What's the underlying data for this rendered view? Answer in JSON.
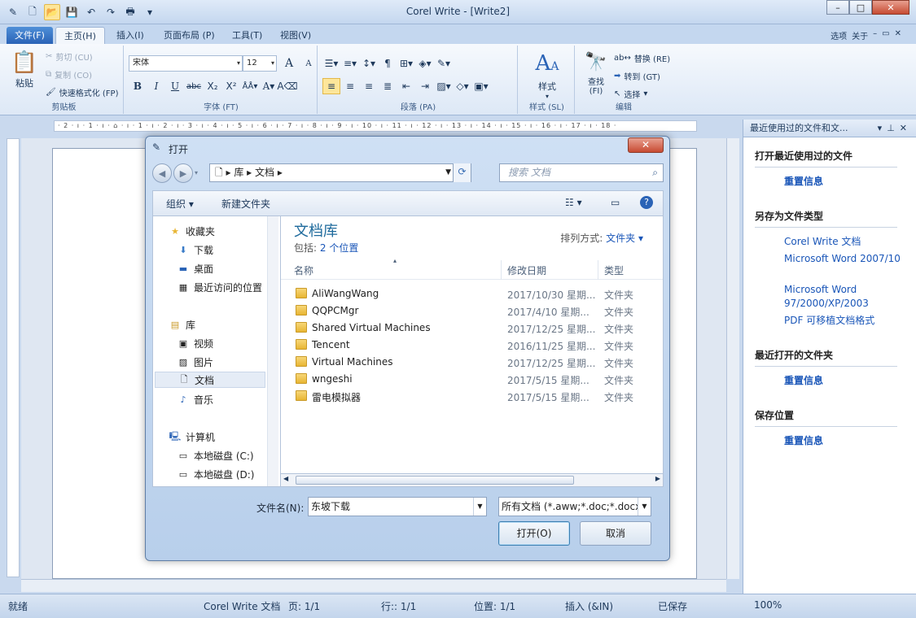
{
  "window": {
    "title": "Corel Write - [Write2]",
    "controls": [
      "–",
      "□",
      "✕"
    ]
  },
  "ribbon_tabs": [
    "文件(F)",
    "主页(H)",
    "插入(I)",
    "页面布局 (P)",
    "工具(T)",
    "视图(V)"
  ],
  "ribbon_right": {
    "options": "选项",
    "about": "关于"
  },
  "clipboard": {
    "paste": "粘贴",
    "cut": "剪切 (CU)",
    "copy": "复制 (CO)",
    "format_painter": "快速格式化 (FP)",
    "label": "剪贴板"
  },
  "font": {
    "name": "宋体",
    "size": "12",
    "label": "字体 (FT)"
  },
  "paragraph": {
    "label": "段落 (PA)"
  },
  "styles": {
    "button": "样式",
    "label": "样式 (SL)"
  },
  "editing": {
    "find": "查找",
    "find_key": "(FI)",
    "replace": "替换 (RE)",
    "goto": "转到 (GT)",
    "select": "选择",
    "label": "编辑"
  },
  "ruler_text": "· 2 · ı · 1 · ı · ⌂ · ı · 1 · ı · 2 · ı · 3 · ı · 4 · ı · 5 · ı · 6 · ı · 7 · ı · 8 · ı · 9 · ı · 10 · ı · 11 · ı · 12 · ı · 13 · ı · 14 · ı · 15 · ı · 16 · ı · 17 · ı · 18 ·",
  "pane": {
    "title": "最近使用过的文件和文...",
    "sections": [
      {
        "heading": "打开最近使用过的文件",
        "links": [
          "重置信息"
        ]
      },
      {
        "heading": "另存为文件类型",
        "links": [
          "Corel Write 文档",
          "Microsoft Word 2007/10",
          "Microsoft Word 97/2000/XP/2003",
          "PDF 可移植文档格式"
        ]
      },
      {
        "heading": "最近打开的文件夹",
        "links": [
          "重置信息"
        ]
      },
      {
        "heading": "保存位置",
        "links": [
          "重置信息"
        ]
      }
    ]
  },
  "statusbar": {
    "ready": "就绪",
    "doctype": "Corel Write 文档",
    "page": "页: 1/1",
    "line": "行:: 1/1",
    "position": "位置: 1/1",
    "insert": "插入 (&IN)",
    "saved": "已保存",
    "zoom": "100%"
  },
  "dialog": {
    "title": "打开",
    "path": [
      "库",
      "文档"
    ],
    "search_placeholder": "搜索 文档",
    "organize": "组织 ▾",
    "new_folder": "新建文件夹",
    "nav": {
      "favorites": "收藏夹",
      "favorites_items": [
        "下载",
        "桌面",
        "最近访问的位置"
      ],
      "libraries": "库",
      "library_items": [
        "视频",
        "图片",
        "文档",
        "音乐"
      ],
      "computer": "计算机",
      "computer_items": [
        "本地磁盘 (C:)",
        "本地磁盘 (D:)"
      ]
    },
    "library_title": "文档库",
    "includes_label": "包括:",
    "includes_link": "2 个位置",
    "sort_label": "排列方式:",
    "sort_value": "文件夹 ▾",
    "columns": [
      "名称",
      "修改日期",
      "类型"
    ],
    "files": [
      {
        "name": "AliWangWang",
        "date": "2017/10/30 星期...",
        "type": "文件夹"
      },
      {
        "name": "QQPCMgr",
        "date": "2017/4/10 星期...",
        "type": "文件夹"
      },
      {
        "name": "Shared Virtual Machines",
        "date": "2017/12/25 星期...",
        "type": "文件夹"
      },
      {
        "name": "Tencent",
        "date": "2016/11/25 星期...",
        "type": "文件夹"
      },
      {
        "name": "Virtual Machines",
        "date": "2017/12/25 星期...",
        "type": "文件夹"
      },
      {
        "name": "wngeshi",
        "date": "2017/5/15 星期...",
        "type": "文件夹"
      },
      {
        "name": "雷电模拟器",
        "date": "2017/5/15 星期...",
        "type": "文件夹"
      }
    ],
    "filename_label": "文件名(N):",
    "filename_value": "东坡下载",
    "filetype_value": "所有文档 (*.aww;*.doc;*.docx;",
    "open_button": "打开(O)",
    "cancel_button": "取消"
  }
}
